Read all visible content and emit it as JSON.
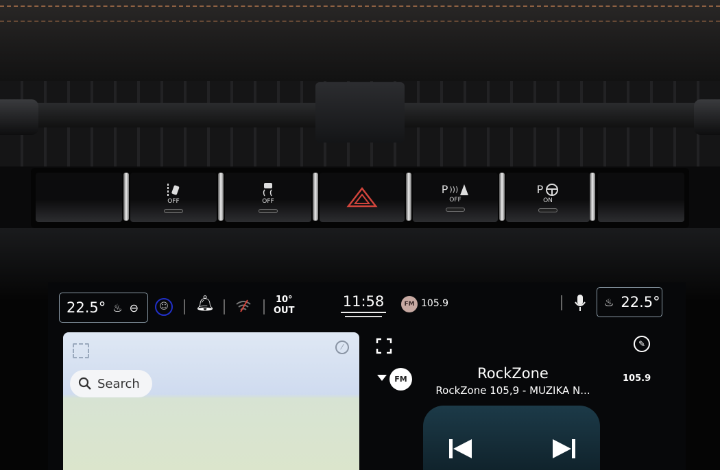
{
  "buttons": [
    {
      "name": "blank",
      "label": ""
    },
    {
      "name": "lane-assist",
      "label": "OFF"
    },
    {
      "name": "traction-control",
      "label": "OFF"
    },
    {
      "name": "hazard",
      "label": ""
    },
    {
      "name": "park-sensors",
      "label": "OFF",
      "prefix": "P"
    },
    {
      "name": "park-assist",
      "label": "ON",
      "prefix": "P"
    },
    {
      "name": "blank",
      "label": ""
    }
  ],
  "status": {
    "driver_temp": "22.5°",
    "passenger_temp": "22.5°",
    "outside_temp": "10°",
    "outside_label": "OUT",
    "time": "11:58",
    "radio_badge": "FM",
    "radio_freq": "105.9"
  },
  "map": {
    "search_label": "Search"
  },
  "media": {
    "band": "FM",
    "station": "RockZone",
    "subtitle": "RockZone 105,9 - MUZIKA N...",
    "frequency": "105.9"
  },
  "colors": {
    "hazard": "#d2453c",
    "accent_ring": "#2130c8",
    "stitch": "#a8704a"
  }
}
